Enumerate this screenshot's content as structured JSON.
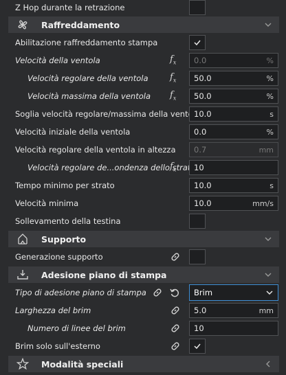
{
  "rows": {
    "zhop": {
      "label": "Z Hop durante la retrazione"
    },
    "cat_cooling": {
      "title": "Raffreddamento"
    },
    "enable_cooling": {
      "label": "Abilitazione raffreddamento stampa"
    },
    "fan_speed": {
      "label": "Velocità della ventola",
      "value": "0.0",
      "unit": "%"
    },
    "fan_regular": {
      "label": "Velocità regolare della ventola",
      "value": "50.0",
      "unit": "%"
    },
    "fan_max": {
      "label": "Velocità massima della ventola",
      "value": "50.0",
      "unit": "%"
    },
    "threshold": {
      "label": "Soglia velocità regolare/massima della ventola",
      "value": "10.0",
      "unit": "s"
    },
    "initial_fan": {
      "label": "Velocità iniziale della ventola",
      "value": "0.0",
      "unit": "%"
    },
    "fan_height": {
      "label": "Velocità regolare della ventola in altezza",
      "value": "0.7",
      "unit": "mm"
    },
    "fan_layer": {
      "label": "Velocità regolare de...ondenza dello strato",
      "value": "10"
    },
    "min_layer_time": {
      "label": "Tempo minimo per strato",
      "value": "10.0",
      "unit": "s"
    },
    "min_speed": {
      "label": "Velocità minima",
      "value": "10.0",
      "unit": "mm/s"
    },
    "lift_head": {
      "label": "Sollevamento della testina"
    },
    "cat_support": {
      "title": "Supporto"
    },
    "gen_support": {
      "label": "Generazione supporto"
    },
    "cat_adhesion": {
      "title": "Adesione piano di stampa"
    },
    "adhesion_type": {
      "label": "Tipo di adesione piano di stampa",
      "value": "Brim"
    },
    "brim_width": {
      "label": "Larghezza del brim",
      "value": "5.0",
      "unit": "mm"
    },
    "brim_lines": {
      "label": "Numero di linee del brim",
      "value": "10"
    },
    "brim_outside": {
      "label": "Brim solo sull'esterno"
    },
    "cat_special": {
      "title": "Modalità speciali"
    }
  },
  "icons": {
    "cooling": "fan-icon",
    "support": "support-icon",
    "adhesion": "adhesion-icon",
    "special": "star-icon",
    "function": "function-fx-icon",
    "link": "link-icon",
    "reset": "reset-icon"
  },
  "colors": {
    "background": "#2b2c2e",
    "category": "#3a3b3e",
    "field": "#1e1f21",
    "accent": "#3f8fd6"
  }
}
